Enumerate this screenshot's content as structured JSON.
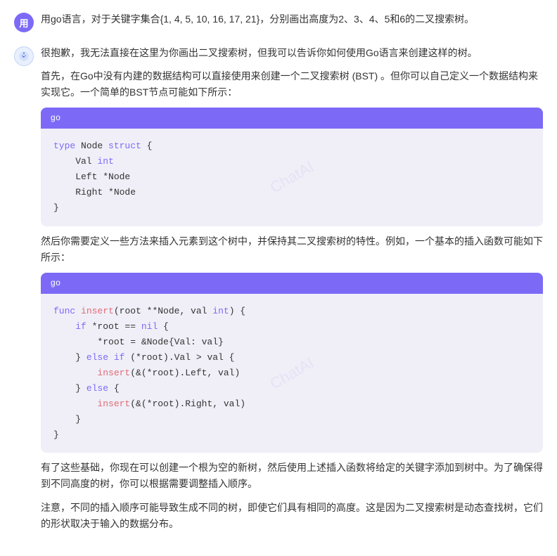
{
  "messages": [
    {
      "id": "user-msg",
      "role": "user",
      "avatar_label": "用",
      "text": "用go语言，对于关键字集合{1, 4, 5, 10, 16, 17, 21}，分别画出高度为2、3、4、5和6的二叉搜索树。"
    },
    {
      "id": "ai-msg",
      "role": "ai",
      "paragraphs": [
        "很抱歉，我无法直接在这里为你画出二叉搜索树，但我可以告诉你如何使用Go语言来创建这样的树。",
        "首先，在Go中没有内建的数据结构可以直接使用来创建一个二叉搜索树 (BST) 。但你可以自己定义一个数据结构来实现它。一个简单的BST节点可能如下所示：",
        "CODEBLOCK_1",
        "然后你需要定义一些方法来插入元素到这个树中，并保持其二叉搜索树的特性。例如，一个基本的插入函数可能如下所示：",
        "CODEBLOCK_2",
        "有了这些基础，你现在可以创建一个根为空的新树，然后使用上述插入函数将给定的关键字添加到树中。为了确保得到不同高度的树，你可以根据需要调整插入顺序。",
        "注意，不同的插入顺序可能导致生成不同的树，即使它们具有相同的高度。这是因为二叉搜索树是动态查找树，它们的形状取决于输入的数据分布。"
      ],
      "code_blocks": {
        "1": {
          "lang": "go",
          "lines": [
            "type Node struct {",
            "    Val int",
            "    Left *Node",
            "    Right *Node",
            "}"
          ]
        },
        "2": {
          "lang": "go",
          "lines": [
            "func insert(root **Node, val int) {",
            "    if *root == nil {",
            "        *root = &Node{Val: val}",
            "    } else if (*root).Val > val {",
            "        insert(&(*root).Left, val)",
            "    } else {",
            "        insert(&(*root).Right, val)",
            "    }",
            "}"
          ]
        }
      }
    }
  ],
  "labels": {
    "go": "go",
    "user_icon": "用"
  }
}
